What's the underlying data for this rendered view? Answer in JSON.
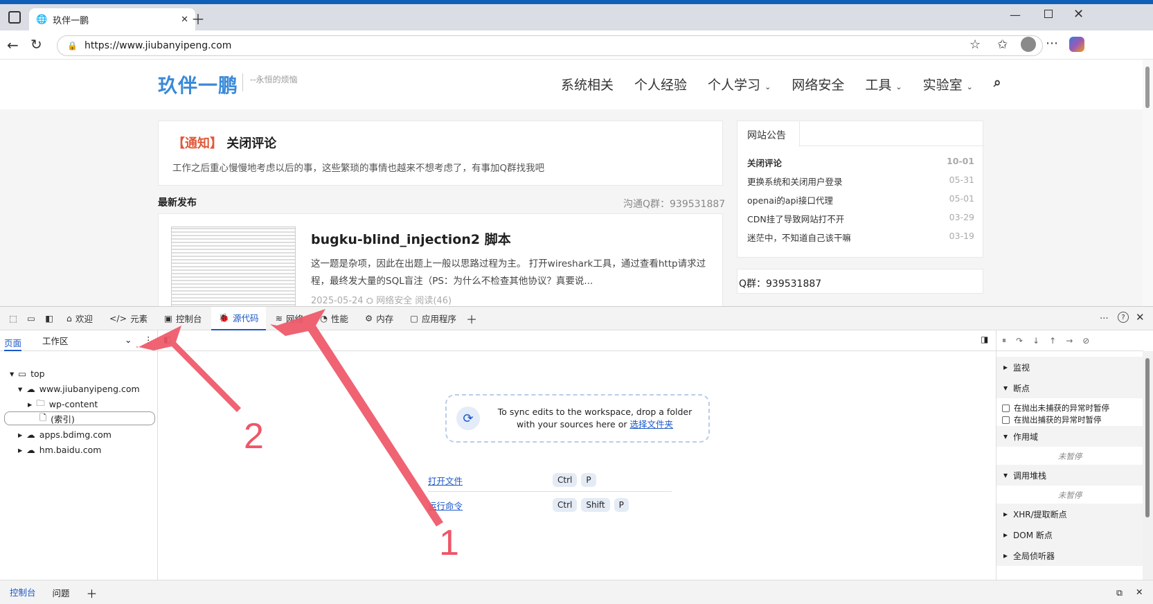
{
  "browser": {
    "tab_title": "玖伴一鹏",
    "url": "https://www.jiubanyipeng.com"
  },
  "site": {
    "logo": "玖伴一鹏",
    "tagline": "--永恒的烦恼",
    "nav": [
      "系统相关",
      "个人经验",
      "个人学习",
      "网络安全",
      "工具",
      "实验室"
    ],
    "notice_tag": "【通知】",
    "notice_title": "关闭评论",
    "notice_body": "工作之后重心慢慢地考虑以后的事，这些繁琐的事情也越来不想考虑了，有事加Q群找我吧",
    "latest_label": "最新发布",
    "qq_group_line": "沟通Q群：939531887",
    "post_title": "bugku-blind_injection2 脚本",
    "post_body": "这一题是杂项，因此在出题上一般以思路过程为主。 打开wireshark工具，通过查看http请求过程，最终发大量的SQL盲注（PS：为什么不检查其他协议？真要说...",
    "post_meta": "2025-05-24   ⛭ 网络安全   阅读(46)",
    "announce_title": "网站公告",
    "announcements": [
      {
        "title": "关闭评论",
        "date": "10-01"
      },
      {
        "title": "更换系统和关闭用户登录",
        "date": "05-31"
      },
      {
        "title": "openai的api接口代理",
        "date": "05-01"
      },
      {
        "title": "CDN挂了导致网站打不开",
        "date": "03-29"
      },
      {
        "title": "迷茫中，不知道自己该干嘛",
        "date": "03-19"
      }
    ],
    "qq_group_box": "Q群：939531887"
  },
  "devtools": {
    "tabs": [
      "欢迎",
      "元素",
      "控制台",
      "源代码",
      "网络",
      "性能",
      "内存",
      "应用程序"
    ],
    "active_tab": "源代码",
    "nav_tabs": [
      "页面",
      "工作区"
    ],
    "tree": [
      "top",
      "www.jiubanyipeng.com",
      "wp-content",
      "(索引)",
      "apps.bdimg.com",
      "hm.baidu.com"
    ],
    "drop_text": "To sync edits to the workspace, drop a folder with your sources here or",
    "drop_link": "选择文件夹",
    "shortcut_open": "打开文件",
    "shortcut_run": "运行命令",
    "keys_open": [
      "Ctrl",
      "P"
    ],
    "keys_run": [
      "Ctrl",
      "Shift",
      "P"
    ],
    "right_sections": {
      "watch": "监视",
      "breakpoints": "断点",
      "pause_uncaught": "在抛出未捕获的异常时暂停",
      "pause_caught": "在抛出捕获的异常时暂停",
      "scope": "作用域",
      "not_paused": "未暂停",
      "callstack": "调用堆栈",
      "xhr": "XHR/提取断点",
      "dom": "DOM 断点",
      "global": "全局侦听器"
    },
    "drawer_tabs": [
      "控制台",
      "问题"
    ]
  },
  "annotations": {
    "label1": "1",
    "label2": "2",
    "color": "#ee5667"
  }
}
